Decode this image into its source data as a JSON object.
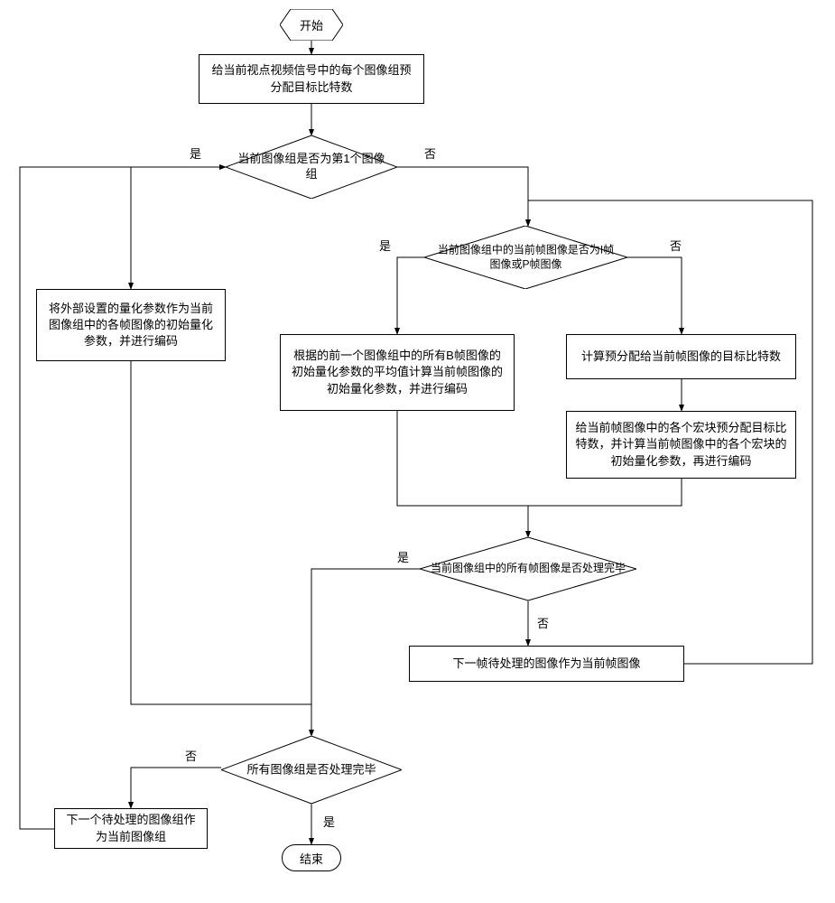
{
  "terminators": {
    "start": "开始",
    "end": "结束"
  },
  "processes": {
    "p1": "给当前视点视频信号中的每个图像组预分配目标比特数",
    "p_left": "将外部设置的量化参数作为当前图像组中的各帧图像的初始量化参数，并进行编码",
    "p_mid": "根据的前一个图像组中的所有B帧图像的初始量化参数的平均值计算当前帧图像的初始量化参数，并进行编码",
    "p_r1": "计算预分配给当前帧图像的目标比特数",
    "p_r2": "给当前帧图像中的各个宏块预分配目标比特数，并计算当前帧图像中的各个宏块的初始量化参数，再进行编码",
    "p_nextframe": "下一帧待处理的图像作为当前帧图像",
    "p_nextgroup": "下一个待处理的图像组作为当前图像组"
  },
  "decisions": {
    "d1": "当前图像组是否为第1个图像组",
    "d2": "当前图像组中的当前帧图像是否为I帧图像或P帧图像",
    "d3": "当前图像组中的所有帧图像是否处理完毕",
    "d4": "所有图像组是否处理完毕"
  },
  "labels": {
    "yes": "是",
    "no": "否"
  },
  "chart_data": {
    "type": "flowchart",
    "description": "Rate control flowchart for video encoding based on image groups (GOPs) and frame types",
    "nodes": [
      {
        "id": "start",
        "type": "terminator",
        "label": "开始"
      },
      {
        "id": "p1",
        "type": "process",
        "label": "给当前视点视频信号中的每个图像组预分配目标比特数"
      },
      {
        "id": "d1",
        "type": "decision",
        "label": "当前图像组是否为第1个图像组"
      },
      {
        "id": "p_left",
        "type": "process",
        "label": "将外部设置的量化参数作为当前图像组中的各帧图像的初始量化参数，并进行编码"
      },
      {
        "id": "d2",
        "type": "decision",
        "label": "当前图像组中的当前帧图像是否为I帧图像或P帧图像"
      },
      {
        "id": "p_mid",
        "type": "process",
        "label": "根据的前一个图像组中的所有B帧图像的初始量化参数的平均值计算当前帧图像的初始量化参数，并进行编码"
      },
      {
        "id": "p_r1",
        "type": "process",
        "label": "计算预分配给当前帧图像的目标比特数"
      },
      {
        "id": "p_r2",
        "type": "process",
        "label": "给当前帧图像中的各个宏块预分配目标比特数，并计算当前帧图像中的各个宏块的初始量化参数，再进行编码"
      },
      {
        "id": "d3",
        "type": "decision",
        "label": "当前图像组中的所有帧图像是否处理完毕"
      },
      {
        "id": "p_nextframe",
        "type": "process",
        "label": "下一帧待处理的图像作为当前帧图像"
      },
      {
        "id": "d4",
        "type": "decision",
        "label": "所有图像组是否处理完毕"
      },
      {
        "id": "p_nextgroup",
        "type": "process",
        "label": "下一个待处理的图像组作为当前图像组"
      },
      {
        "id": "end",
        "type": "terminator",
        "label": "结束"
      }
    ],
    "edges": [
      {
        "from": "start",
        "to": "p1"
      },
      {
        "from": "p1",
        "to": "d1"
      },
      {
        "from": "d1",
        "to": "p_left",
        "label": "是"
      },
      {
        "from": "d1",
        "to": "d2",
        "label": "否"
      },
      {
        "from": "d2",
        "to": "p_mid",
        "label": "是"
      },
      {
        "from": "d2",
        "to": "p_r1",
        "label": "否"
      },
      {
        "from": "p_r1",
        "to": "p_r2"
      },
      {
        "from": "p_mid",
        "to": "d3"
      },
      {
        "from": "p_r2",
        "to": "d3"
      },
      {
        "from": "d3",
        "to": "p_nextframe",
        "label": "否"
      },
      {
        "from": "p_nextframe",
        "to": "d2"
      },
      {
        "from": "d3",
        "to": "d4",
        "label": "是"
      },
      {
        "from": "p_left",
        "to": "d4"
      },
      {
        "from": "d4",
        "to": "p_nextgroup",
        "label": "否"
      },
      {
        "from": "p_nextgroup",
        "to": "d1"
      },
      {
        "from": "d4",
        "to": "end",
        "label": "是"
      }
    ]
  }
}
